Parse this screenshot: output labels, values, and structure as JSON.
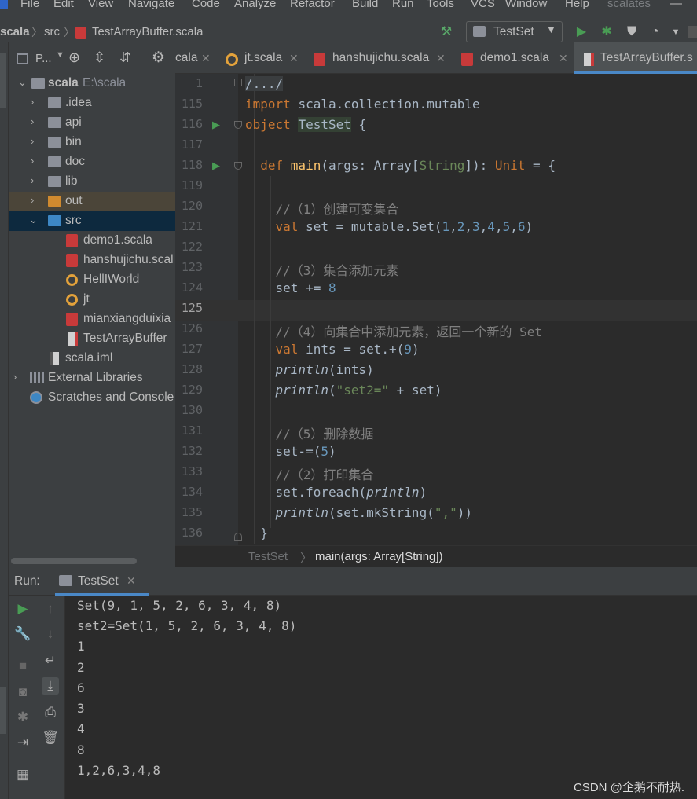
{
  "menu": [
    "File",
    "Edit",
    "View",
    "Navigate",
    "Code",
    "Analyze",
    "Refactor",
    "Build",
    "Run",
    "Tools",
    "VCS",
    "Window",
    "Help"
  ],
  "window_project": "scalates",
  "window_minimize": "—",
  "breadcrumb": [
    "scala",
    "src",
    "TestArrayBuffer.scala"
  ],
  "run_config": "TestSet",
  "project_panel": {
    "title": "P...",
    "tree": [
      {
        "label": "scala",
        "path": "E:\\scala"
      },
      {
        "label": ".idea"
      },
      {
        "label": "api"
      },
      {
        "label": "bin"
      },
      {
        "label": "doc"
      },
      {
        "label": "lib"
      },
      {
        "label": "out"
      },
      {
        "label": "src"
      },
      {
        "label": "demo1.scala"
      },
      {
        "label": "hanshujichu.scal"
      },
      {
        "label": "HellIWorld"
      },
      {
        "label": "jt"
      },
      {
        "label": "mianxiangduixia"
      },
      {
        "label": "TestArrayBuffer"
      },
      {
        "label": "scala.iml"
      },
      {
        "label": "External Libraries"
      },
      {
        "label": "Scratches and Console"
      }
    ]
  },
  "tabs": [
    {
      "label": "cala"
    },
    {
      "label": "jt.scala"
    },
    {
      "label": "hanshujichu.scala"
    },
    {
      "label": "demo1.scala"
    },
    {
      "label": "TestArrayBuffer.s",
      "active": true
    }
  ],
  "editor": {
    "line_numbers": [
      "1",
      "115",
      "116",
      "117",
      "118",
      "119",
      "120",
      "121",
      "122",
      "123",
      "124",
      "125",
      "126",
      "127",
      "128",
      "129",
      "130",
      "131",
      "132",
      "133",
      "134",
      "135",
      "136"
    ],
    "lines": [
      "/.../",
      "import scala.collection.mutable",
      "object TestSet {",
      "",
      "  def main(args: Array[String]): Unit = {",
      "",
      "    //（1）创建可变集合",
      "    val set = mutable.Set(1,2,3,4,5,6)",
      "",
      "    //（3）集合添加元素",
      "    set += 8",
      "",
      "    //（4）向集合中添加元素，返回一个新的 Set",
      "    val ints = set.+(9)",
      "    println(ints)",
      "    println(\"set2=\" + set)",
      "",
      "    //（5）删除数据",
      "    set-=(5)",
      "    //（2）打印集合",
      "    set.foreach(println)",
      "    println(set.mkString(\",\"))",
      "  }"
    ],
    "crumbs": [
      "TestSet",
      "main(args: Array[String])"
    ]
  },
  "run_panel": {
    "label": "Run:",
    "tab": "TestSet",
    "output": [
      "Set(9, 1, 5, 2, 6, 3, 4, 8)",
      "set2=Set(1, 5, 2, 6, 3, 4, 8)",
      "1",
      "2",
      "6",
      "3",
      "4",
      "8",
      "1,2,6,3,4,8"
    ]
  },
  "watermark": "CSDN @企鹅不耐热.",
  "colors": {
    "accent": "#4a88c7",
    "keyword": "#cc7832",
    "string": "#6a8759",
    "number": "#6897bb",
    "run_green": "#499c54"
  }
}
